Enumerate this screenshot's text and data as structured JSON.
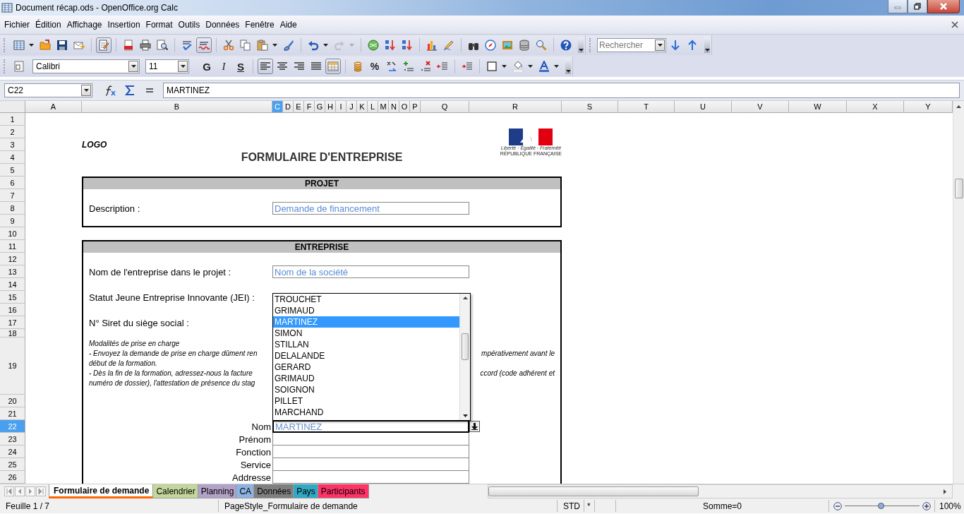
{
  "window": {
    "title": "Document récap.ods - OpenOffice.org Calc"
  },
  "menu": [
    "Fichier",
    "Édition",
    "Affichage",
    "Insertion",
    "Format",
    "Outils",
    "Données",
    "Fenêtre",
    "Aide"
  ],
  "standard_toolbar": [
    {
      "pressed": false,
      "disabled": false
    },
    {
      "pressed": false,
      "disabled": false
    },
    {
      "pressed": false,
      "disabled": false
    },
    {
      "pressed": false,
      "disabled": false
    },
    {
      "pressed": true,
      "disabled": false
    },
    {
      "pressed": false,
      "disabled": false
    },
    {
      "pressed": false,
      "disabled": false
    },
    {
      "pressed": false,
      "disabled": false
    },
    {
      "pressed": false,
      "disabled": false
    },
    {
      "pressed": true,
      "disabled": false
    },
    {
      "pressed": false,
      "disabled": false
    },
    {
      "pressed": false,
      "disabled": false
    },
    {
      "pressed": false,
      "disabled": false
    },
    {
      "pressed": false,
      "disabled": false
    },
    {
      "pressed": false,
      "disabled": false
    },
    {
      "pressed": false,
      "disabled": true
    },
    {
      "pressed": false,
      "disabled": false
    },
    {
      "pressed": false,
      "disabled": false
    },
    {
      "pressed": false,
      "disabled": false
    },
    {
      "pressed": false,
      "disabled": false
    },
    {
      "pressed": false,
      "disabled": false
    },
    {
      "pressed": false,
      "disabled": false
    },
    {
      "pressed": false,
      "disabled": false
    },
    {
      "pressed": false,
      "disabled": false
    },
    {
      "pressed": false,
      "disabled": false
    },
    {
      "pressed": false,
      "disabled": false
    },
    {
      "pressed": false,
      "disabled": false
    }
  ],
  "search_toolbar": {
    "placeholder": "Rechercher"
  },
  "formatting_toolbar": {
    "font_name": "Calibri",
    "font_size": "11",
    "buttons": [
      {
        "kind": "text",
        "label": "G",
        "pressed": false
      },
      {
        "kind": "text",
        "label": "I",
        "pressed": false
      },
      {
        "kind": "text",
        "label": "S",
        "pressed": false
      },
      {
        "kind": "icon",
        "pressed": true
      },
      {
        "kind": "icon",
        "pressed": false
      },
      {
        "kind": "icon",
        "pressed": false
      },
      {
        "kind": "icon",
        "pressed": false
      },
      {
        "kind": "icon",
        "pressed": true
      },
      {
        "kind": "icon",
        "pressed": false
      },
      {
        "kind": "text",
        "label": "%",
        "pressed": false
      },
      {
        "kind": "icon",
        "pressed": false
      },
      {
        "kind": "icon",
        "pressed": false
      },
      {
        "kind": "icon",
        "pressed": false
      },
      {
        "kind": "icon",
        "pressed": false
      },
      {
        "kind": "icon",
        "pressed": false
      },
      {
        "kind": "icon",
        "pressed": false
      },
      {
        "kind": "icon",
        "pressed": false
      },
      {
        "kind": "icon",
        "pressed": false
      }
    ]
  },
  "formula_bar": {
    "cell_reference": "C22",
    "content": "MARTINEZ"
  },
  "columns": [
    {
      "label": "A",
      "selected": false
    },
    {
      "label": "B",
      "selected": false
    },
    {
      "label": "C",
      "selected": true
    },
    {
      "label": "D",
      "selected": false
    },
    {
      "label": "E",
      "selected": false
    },
    {
      "label": "F",
      "selected": false
    },
    {
      "label": "G",
      "selected": false
    },
    {
      "label": "H",
      "selected": false
    },
    {
      "label": "I",
      "selected": false
    },
    {
      "label": "J",
      "selected": false
    },
    {
      "label": "K",
      "selected": false
    },
    {
      "label": "L",
      "selected": false
    },
    {
      "label": "M",
      "selected": false
    },
    {
      "label": "N",
      "selected": false
    },
    {
      "label": "O",
      "selected": false
    },
    {
      "label": "P",
      "selected": false
    },
    {
      "label": "Q",
      "selected": false
    },
    {
      "label": "R",
      "selected": false
    },
    {
      "label": "S",
      "selected": false
    },
    {
      "label": "T",
      "selected": false
    },
    {
      "label": "U",
      "selected": false
    },
    {
      "label": "V",
      "selected": false
    },
    {
      "label": "W",
      "selected": false
    },
    {
      "label": "X",
      "selected": false
    },
    {
      "label": "Y",
      "selected": false
    }
  ],
  "rows": [
    {
      "label": "1",
      "selected": false
    },
    {
      "label": "2",
      "selected": false
    },
    {
      "label": "3",
      "selected": false
    },
    {
      "label": "4",
      "selected": false
    },
    {
      "label": "5",
      "selected": false
    },
    {
      "label": "6",
      "selected": false
    },
    {
      "label": "7",
      "selected": false
    },
    {
      "label": "8",
      "selected": false
    },
    {
      "label": "9",
      "selected": false
    },
    {
      "label": "10",
      "selected": false
    },
    {
      "label": "11",
      "selected": false
    },
    {
      "label": "12",
      "selected": false
    },
    {
      "label": "13",
      "selected": false
    },
    {
      "label": "14",
      "selected": false
    },
    {
      "label": "15",
      "selected": false
    },
    {
      "label": "16",
      "selected": false
    },
    {
      "label": "17",
      "selected": false
    },
    {
      "label": "18",
      "selected": false
    },
    {
      "label": "19",
      "selected": false
    },
    {
      "label": "20",
      "selected": false
    },
    {
      "label": "21",
      "selected": false
    },
    {
      "label": "22",
      "selected": true
    },
    {
      "label": "23",
      "selected": false
    },
    {
      "label": "24",
      "selected": false
    },
    {
      "label": "25",
      "selected": false
    },
    {
      "label": "26",
      "selected": false
    }
  ],
  "sheet": {
    "logo": "LOGO",
    "title": "FORMULAIRE D'ENTREPRISE",
    "emblem": {
      "motto": "Liberté · Égalité · Fraternité",
      "name": "RÉPUBLIQUE FRANÇAISE"
    },
    "projet": {
      "header": "PROJET",
      "description_label": "Description :",
      "description_value": "Demande de financement"
    },
    "entreprise": {
      "header": "ENTREPRISE",
      "company_label": "Nom de l'entreprise dans le projet :",
      "company_value": "Nom de la société",
      "jei_label": "Statut Jeune Entreprise Innovante (JEI) :",
      "siret_label": "N° Siret du siège social :",
      "notes": [
        {
          "left": "Modalités de prise en charge"
        },
        {
          "left": "- Envoyez la demande de prise en charge dûment ren",
          "right": "mpérativement avant le"
        },
        {
          "left": "début de la formation."
        },
        {
          "left": "- Dès la fin de la formation, adressez-nous la facture",
          "right": "ccord (code adhérent et"
        },
        {
          "left": "numéro de dossier), l'attestation de présence du stag"
        }
      ],
      "contact_fields": [
        {
          "label": "Nom",
          "value": "MARTINEZ",
          "selected": true
        },
        {
          "label": "Prénom",
          "selected": false
        },
        {
          "label": "Fonction",
          "selected": false
        },
        {
          "label": "Service",
          "selected": false
        },
        {
          "label": "Addresse",
          "selected": false
        }
      ]
    }
  },
  "dropdown_list": [
    {
      "label": "TROUCHET",
      "selected": false
    },
    {
      "label": "GRIMAUD",
      "selected": false
    },
    {
      "label": "MARTINEZ",
      "selected": true
    },
    {
      "label": "SIMON",
      "selected": false
    },
    {
      "label": "STILLAN",
      "selected": false
    },
    {
      "label": "DELALANDE",
      "selected": false
    },
    {
      "label": "GERARD",
      "selected": false
    },
    {
      "label": "GRIMAUD",
      "selected": false
    },
    {
      "label": "SOIGNON",
      "selected": false
    },
    {
      "label": "PILLET",
      "selected": false
    },
    {
      "label": "MARCHAND",
      "selected": false
    }
  ],
  "sheet_tabs": [
    {
      "label": "Formulaire de demande",
      "selected": true,
      "color": "#ff6600"
    },
    {
      "label": "Calendrier",
      "selected": false,
      "color": "#c3d69b"
    },
    {
      "label": "Planning",
      "selected": false,
      "color": "#b3a2c7"
    },
    {
      "label": "CA",
      "selected": false,
      "color": "#8db3e2"
    },
    {
      "label": "Données",
      "selected": false,
      "color": "#7f7f7f"
    },
    {
      "label": "Pays",
      "selected": false,
      "color": "#31a9c4"
    },
    {
      "label": "Participants",
      "selected": false,
      "color": "#ff3366"
    }
  ],
  "status_bar": {
    "sheet": "Feuille 1 / 7",
    "page_style": "PageStyle_Formulaire de demande",
    "selection_mode": "STD",
    "modified": "*",
    "sum": "Somme=0",
    "zoom": {
      "level": 0.48
    },
    "zoom_percent": "100%"
  }
}
